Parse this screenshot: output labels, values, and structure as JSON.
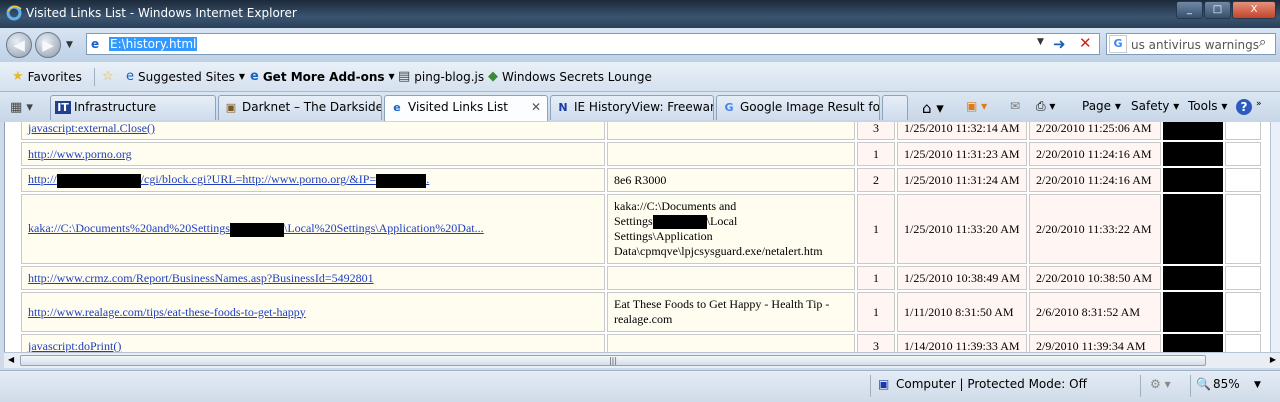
{
  "window": {
    "title": "Visited Links List - Windows Internet Explorer",
    "btn_min": "_",
    "btn_max": "□",
    "btn_close": "X"
  },
  "nav": {
    "back": "◀",
    "forward": "▶",
    "dropdown": "▼"
  },
  "address": {
    "url": "E:\\history.html",
    "go": "➜",
    "stop": "✕",
    "drop": "▼"
  },
  "search": {
    "engine_icon": "G",
    "query": "us antivirus warnings",
    "icon": "⌕"
  },
  "favorites": {
    "label": "Favorites",
    "items": [
      {
        "label": "Suggested Sites",
        "has_menu": true
      },
      {
        "label": "Get More Add-ons",
        "has_menu": true
      },
      {
        "label": "ping-blog.js",
        "has_menu": false
      },
      {
        "label": "Windows Secrets Lounge",
        "has_menu": false
      }
    ]
  },
  "tabs": [
    {
      "label": "Infrastructure",
      "icon": "IT"
    },
    {
      "label": "Darknet – The Darkside |...",
      "icon": "▣"
    },
    {
      "label": "Visited Links List",
      "icon": "e",
      "active": true
    },
    {
      "label": "IE HistoryView: Freeware...",
      "icon": "N"
    },
    {
      "label": "Google Image Result for...",
      "icon": "G"
    }
  ],
  "commands": {
    "page": "Page",
    "safety": "Safety",
    "tools": "Tools",
    "help": "?"
  },
  "rows": [
    {
      "link": "javascript:external.Close()",
      "title": "",
      "count": "3",
      "first": "1/25/2010 11:32:14 AM",
      "last": "2/20/2010 11:25:06 AM"
    },
    {
      "link": "http://www.porno.org",
      "title": "",
      "count": "1",
      "first": "1/25/2010 11:31:23 AM",
      "last": "2/20/2010 11:24:16 AM"
    },
    {
      "link_a": "http://",
      "link_b": "/cgi/block.cgi?URL=http://www.porno.org/&IP=",
      "link_c": ".",
      "title": "8e6 R3000",
      "count": "2",
      "first": "1/25/2010 11:31:24 AM",
      "last": "2/20/2010 11:24:16 AM"
    },
    {
      "link_a": "kaka://C:\\Documents%20and%20Settings",
      "link_b": "\\Local%20Settings\\Application%20Dat...",
      "title_1": "kaka://C:\\Documents and",
      "title_2a": "Settings",
      "title_2b": "\\Local",
      "title_3": "Settings\\Application",
      "title_4": "Data\\cpmqve\\lpjcsysguard.exe/netalert.htm",
      "count": "1",
      "first": "1/25/2010 11:33:20 AM",
      "last": "2/20/2010 11:33:22 AM"
    },
    {
      "link": "http://www.crmz.com/Report/BusinessNames.asp?BusinessId=5492801",
      "title": "",
      "count": "1",
      "first": "1/25/2010 10:38:49 AM",
      "last": "2/20/2010 10:38:50 AM"
    },
    {
      "link": "http://www.realage.com/tips/eat-these-foods-to-get-happy",
      "title_1": "Eat These Foods to Get Happy - Health Tip -",
      "title_2": "realage.com",
      "count": "1",
      "first": "1/11/2010 8:31:50 AM",
      "last": "2/6/2010 8:31:52 AM"
    },
    {
      "link": "javascript:doPrint()",
      "title": "",
      "count": "3",
      "first": "1/14/2010 11:39:33 AM",
      "last": "2/9/2010 11:39:34 AM"
    }
  ],
  "hscroll_grip": "|||",
  "status": {
    "zone": "Computer | Protected Mode: Off",
    "zoom": "85%"
  }
}
